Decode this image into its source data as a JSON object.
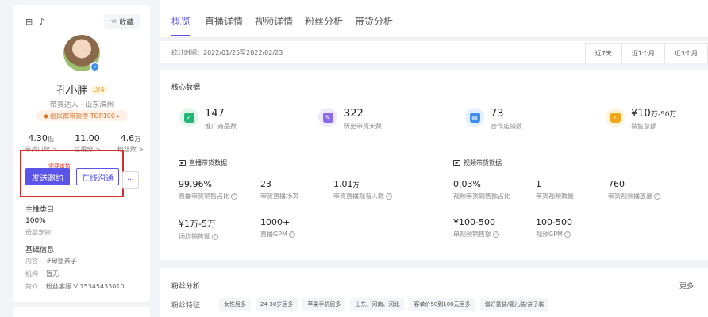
{
  "profile": {
    "fav_label": "收藏",
    "name": "孔小胖",
    "level": "LV4",
    "tags": "带货达人 · 山东滨州",
    "rank": "纸尿裤带货榜 TOP100",
    "stats": [
      {
        "value": "4.30",
        "unit": "低",
        "label": "带货口碑"
      },
      {
        "value": "11.00",
        "unit": "",
        "label": "信用分"
      },
      {
        "value": "4.6",
        "unit": "万",
        "label": "粉丝数"
      }
    ],
    "tip": "需要审核",
    "btn_invite": "发送邀约",
    "btn_chat": "在线沟通",
    "btn_more": "···",
    "category_title": "主推类目",
    "category_pct": "100%",
    "category_name": "母婴宠物",
    "basic_title": "基础信息",
    "basic": [
      {
        "k": "内容",
        "v": "#母婴亲子"
      },
      {
        "k": "机构",
        "v": "暂无"
      },
      {
        "k": "简介",
        "v": "粉丝客服 V 15345433010"
      }
    ]
  },
  "tabs": [
    "概览",
    "直播详情",
    "视频详情",
    "粉丝分析",
    "带货分析"
  ],
  "time": {
    "label": "统计时间：2022/01/25至2022/02/23",
    "ranges": [
      "近7天",
      "近1个月",
      "近3个月"
    ]
  },
  "core": {
    "title": "核心数据",
    "metrics": [
      {
        "value": "147",
        "unit": "",
        "label": "推广商品数",
        "color": "#22b573",
        "ring": "#e3f6ec"
      },
      {
        "value": "322",
        "unit": "",
        "label": "历史带货天数",
        "color": "#8e6be6",
        "ring": "#efe9fc"
      },
      {
        "value": "73",
        "unit": "",
        "label": "合作店铺数",
        "color": "#3b8df0",
        "ring": "#e6f0fd"
      },
      {
        "value": "¥10",
        "unit": "万-50万",
        "label": "销售总额",
        "color": "#f2a71b",
        "ring": "#fdf3df"
      }
    ],
    "live_title": "直播带货数据",
    "live": [
      {
        "value": "99.96%",
        "unit": "",
        "label": "直播带货销售占比",
        "q": true
      },
      {
        "value": "23",
        "unit": "",
        "label": "带货直播场次",
        "q": false
      },
      {
        "value": "1.01",
        "unit": "万",
        "label": "带货直播观看人数",
        "q": true
      },
      {
        "value": "¥1万-5万",
        "unit": "",
        "label": "场均销售额",
        "q": true
      },
      {
        "value": "1000+",
        "unit": "",
        "label": "直播GPM",
        "q": true
      }
    ],
    "video_title": "视频带货数据",
    "video": [
      {
        "value": "0.03%",
        "unit": "",
        "label": "视频带货销售额占比",
        "q": false
      },
      {
        "value": "1",
        "unit": "",
        "label": "带货视频数量",
        "q": false
      },
      {
        "value": "760",
        "unit": "",
        "label": "带货视频播放量",
        "q": true
      },
      {
        "value": "¥100-500",
        "unit": "",
        "label": "单视频销售额",
        "q": true
      },
      {
        "value": "100-500",
        "unit": "",
        "label": "视频GPM",
        "q": true
      }
    ]
  },
  "fans": {
    "title": "粉丝分析",
    "more": "更多",
    "feature_label": "粉丝特征",
    "chips": [
      "女性居多",
      "24-30岁居多",
      "苹果手机居多",
      "山东、河南、河北",
      "客单价50到100元居多",
      "偏好童装/婴儿装/亲子装"
    ]
  }
}
